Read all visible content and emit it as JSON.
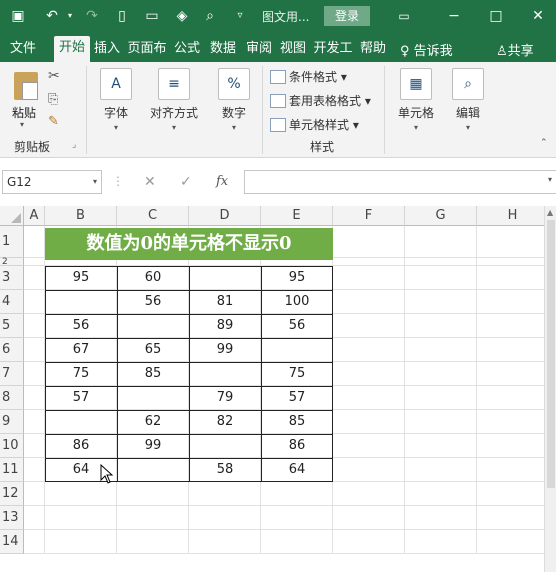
{
  "titlebar": {
    "filename": "图文用...",
    "login_label": "登录"
  },
  "tabs": [
    {
      "label": "文件"
    },
    {
      "label": "开始"
    },
    {
      "label": "插入"
    },
    {
      "label": "页面布"
    },
    {
      "label": "公式"
    },
    {
      "label": "数据"
    },
    {
      "label": "审阅"
    },
    {
      "label": "视图"
    },
    {
      "label": "开发工"
    },
    {
      "label": "帮助"
    }
  ],
  "tell_me": "告诉我",
  "share_label": "共享",
  "ribbon": {
    "paste_label": "粘贴",
    "clipboard_label": "剪贴板",
    "font_label": "字体",
    "align_label": "对齐方式",
    "number_label": "数字",
    "cond_format_label": "条件格式",
    "table_format_label": "套用表格格式",
    "cell_style_label": "单元格样式",
    "styles_label": "样式",
    "cells_label": "单元格",
    "edit_label": "编辑"
  },
  "formula_bar": {
    "name_box": "G12",
    "fx": "fx",
    "content": ""
  },
  "columns": [
    "A",
    "B",
    "C",
    "D",
    "E",
    "F",
    "G",
    "H"
  ],
  "rows": [
    "1",
    "2",
    "3",
    "4",
    "5",
    "6",
    "7",
    "8",
    "9",
    "10",
    "11",
    "12",
    "13",
    "14"
  ],
  "banner_title": "数值为0的单元格不显示0",
  "table": [
    [
      "95",
      "60",
      "",
      "95"
    ],
    [
      "",
      "56",
      "81",
      "100"
    ],
    [
      "56",
      "",
      "89",
      "56"
    ],
    [
      "67",
      "65",
      "99",
      ""
    ],
    [
      "75",
      "85",
      "",
      "75"
    ],
    [
      "57",
      "",
      "79",
      "57"
    ],
    [
      "",
      "62",
      "82",
      "85"
    ],
    [
      "86",
      "99",
      "",
      "86"
    ],
    [
      "64",
      "",
      "58",
      "64"
    ]
  ],
  "colors": {
    "excel_green": "#217346",
    "banner_green": "#70ad47"
  }
}
